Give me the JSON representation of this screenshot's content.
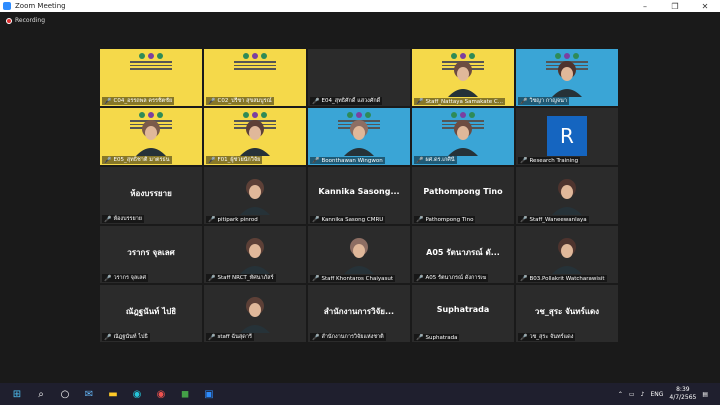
{
  "window": {
    "title": "Zoom Meeting",
    "controls": [
      "–",
      "❐",
      "✕"
    ]
  },
  "recording": {
    "label": "Recording"
  },
  "tiles": [
    {
      "label": "C04_อรรถพล ครรชิตชัย",
      "kind": "slide"
    },
    {
      "label": "C02_ปรีชา สุขสมบูรณ์",
      "kind": "slide"
    },
    {
      "label": "E04_สุทธิศักดิ์ แสวงศักดิ์",
      "kind": "dark"
    },
    {
      "label": "Staff_Nattaya Samakate C...",
      "kind": "person"
    },
    {
      "label": "วิชญา กาญจนา",
      "kind": "person"
    },
    {
      "label": "E05_สุทธิชาติ มาตรธน",
      "kind": "person"
    },
    {
      "label": "F01_ผู้ช่วยนักวิจัย",
      "kind": "person"
    },
    {
      "label": "Boonthawan Wingwon",
      "kind": "person"
    },
    {
      "label": "ผศ.ดร.เกศินี",
      "kind": "person"
    },
    {
      "label": "Research Training",
      "kind": "avatar",
      "initial": "R"
    },
    {
      "label": "ห้องบรรยาย",
      "kind": "name",
      "name": "ห้องบรรยาย"
    },
    {
      "label": "pitipark pinrod",
      "kind": "person"
    },
    {
      "label": "Kannika Sasong CMRU",
      "kind": "name",
      "name": "Kannika Sasong..."
    },
    {
      "label": "Pathompong Tino",
      "kind": "name",
      "name": "Pathompong Tino"
    },
    {
      "label": "Staff_Waneewanlaya",
      "kind": "person"
    },
    {
      "label": "วรากร จุลเลศ",
      "kind": "name",
      "name": "วรากร จุลเลศ"
    },
    {
      "label": "Staff NRCT_ทัศนาภัสร์",
      "kind": "person"
    },
    {
      "label": "Staff Khontaros Chaiyasut",
      "kind": "person"
    },
    {
      "label": "A05 รัตนาภรณ์ ดั่งการเฆ",
      "kind": "name",
      "name": "A05 รัตนาภรณ์ ดั..."
    },
    {
      "label": "B03.Pollakrit Watcharawisit",
      "kind": "person"
    },
    {
      "label": "ณัฎฐนันท์ ไปธิ",
      "kind": "name",
      "name": "ณัฎฐนันท์ ไปธิ"
    },
    {
      "label": "staff ฉันสุดารี",
      "kind": "person"
    },
    {
      "label": "สำนักงานการวิจัยแห่งชาติ",
      "kind": "name",
      "name": "สำนักงานการวิจัย..."
    },
    {
      "label": "Suphatrada",
      "kind": "name",
      "name": "Suphatrada"
    },
    {
      "label": "วช_สุระ จันทร์แดง",
      "kind": "name",
      "name": "วช_สุระ จันทร์แดง"
    }
  ],
  "taskbar": {
    "lang": "ENG",
    "time": "8:39",
    "date": "4/7/2565"
  },
  "colors": {
    "accent": "#2d8cff",
    "slide": "#f5d94a",
    "muted_mic": "#e53935"
  }
}
